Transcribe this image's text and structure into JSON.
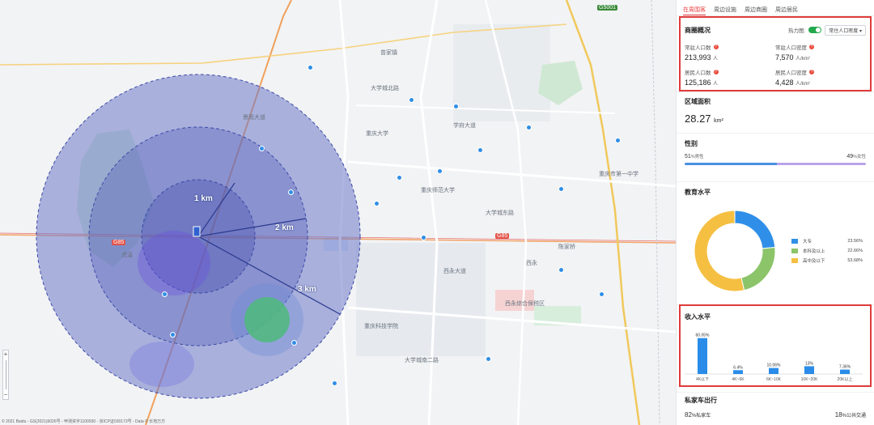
{
  "map": {
    "ring_labels": [
      "1 km",
      "2 km",
      "3 km"
    ],
    "attribution": "© 2021 Baidu - GS(2021)6026号 - 甲测资字1100930 - 京ICP证030173号 - Data © 长地万方",
    "zoom_in": "+",
    "zoom_out": "−",
    "place_labels": [
      "重庆大学",
      "大学城北路",
      "虎溪",
      "西永大道",
      "大学城东路",
      "重庆科技学院",
      "大学城南二路",
      "学府大道",
      "重庆师范大学",
      "景观大道",
      "陈家桥",
      "西永",
      "曾家镇",
      "西永综合保税区",
      "重庆市第一中学"
    ],
    "road_badges": [
      "G85",
      "G5001",
      "G85"
    ]
  },
  "panel": {
    "tabs": [
      {
        "label": "在周围客",
        "active": true
      },
      {
        "label": "周边设施",
        "active": false
      },
      {
        "label": "周边商圈",
        "active": false
      },
      {
        "label": "周边居民",
        "active": false
      }
    ],
    "overview": {
      "title": "商圈概况",
      "heat_label": "热力图:",
      "heat_on": true,
      "select_value": "常住人口密度",
      "metrics": [
        {
          "label": "常驻人口数",
          "value": "213,993",
          "unit": "人"
        },
        {
          "label": "常驻人口密度",
          "value": "7,570",
          "unit": "人/km²"
        },
        {
          "label": "居民人口数",
          "value": "125,186",
          "unit": "人"
        },
        {
          "label": "居民人口密度",
          "value": "4,428",
          "unit": "人/km²"
        }
      ]
    },
    "area": {
      "title": "区域面积",
      "value": "28.27",
      "unit": "km²"
    },
    "gender": {
      "title": "性别",
      "left_pct": "51",
      "left_label": "%男性",
      "right_pct": "49",
      "right_label": "%女性",
      "left_color": "#4a90e2",
      "right_color": "#b9a4e8",
      "left_fraction": 0.51
    },
    "education": {
      "title": "教育水平",
      "segments": [
        {
          "name": "大专",
          "pct": "23.56%",
          "value": 23.56,
          "color": "#2f8fe8"
        },
        {
          "name": "本科及以上",
          "pct": "22.66%",
          "value": 22.66,
          "color": "#8cc46a"
        },
        {
          "name": "高中及以下",
          "pct": "53.68%",
          "value": 53.68,
          "color": "#f5bf42"
        }
      ]
    },
    "income": {
      "title": "收入水平",
      "chart_data": {
        "type": "bar",
        "categories": [
          "4K以下",
          "4K~6K",
          "6K~10K",
          "10K~20K",
          "20K以上"
        ],
        "values": [
          60.05,
          6.4,
          10.06,
          13,
          7.36
        ],
        "value_labels": [
          "60.05%",
          "6.4%",
          "10.06%",
          "13%",
          "7.36%"
        ],
        "ylim": [
          0,
          65
        ],
        "color": "#2a8ce8"
      }
    },
    "car": {
      "title": "私家车出行",
      "left_pct": "82",
      "left_label": "%私家车",
      "right_pct": "18",
      "right_label": "%公共交通"
    }
  }
}
